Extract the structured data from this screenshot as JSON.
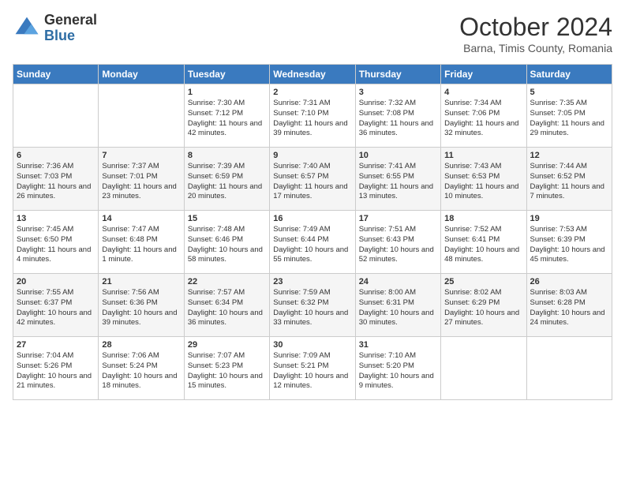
{
  "header": {
    "logo_general": "General",
    "logo_blue": "Blue",
    "month_title": "October 2024",
    "location": "Barna, Timis County, Romania"
  },
  "days_of_week": [
    "Sunday",
    "Monday",
    "Tuesday",
    "Wednesday",
    "Thursday",
    "Friday",
    "Saturday"
  ],
  "weeks": [
    [
      {
        "day": "",
        "sunrise": "",
        "sunset": "",
        "daylight": ""
      },
      {
        "day": "",
        "sunrise": "",
        "sunset": "",
        "daylight": ""
      },
      {
        "day": "1",
        "sunrise": "Sunrise: 7:30 AM",
        "sunset": "Sunset: 7:12 PM",
        "daylight": "Daylight: 11 hours and 42 minutes."
      },
      {
        "day": "2",
        "sunrise": "Sunrise: 7:31 AM",
        "sunset": "Sunset: 7:10 PM",
        "daylight": "Daylight: 11 hours and 39 minutes."
      },
      {
        "day": "3",
        "sunrise": "Sunrise: 7:32 AM",
        "sunset": "Sunset: 7:08 PM",
        "daylight": "Daylight: 11 hours and 36 minutes."
      },
      {
        "day": "4",
        "sunrise": "Sunrise: 7:34 AM",
        "sunset": "Sunset: 7:06 PM",
        "daylight": "Daylight: 11 hours and 32 minutes."
      },
      {
        "day": "5",
        "sunrise": "Sunrise: 7:35 AM",
        "sunset": "Sunset: 7:05 PM",
        "daylight": "Daylight: 11 hours and 29 minutes."
      }
    ],
    [
      {
        "day": "6",
        "sunrise": "Sunrise: 7:36 AM",
        "sunset": "Sunset: 7:03 PM",
        "daylight": "Daylight: 11 hours and 26 minutes."
      },
      {
        "day": "7",
        "sunrise": "Sunrise: 7:37 AM",
        "sunset": "Sunset: 7:01 PM",
        "daylight": "Daylight: 11 hours and 23 minutes."
      },
      {
        "day": "8",
        "sunrise": "Sunrise: 7:39 AM",
        "sunset": "Sunset: 6:59 PM",
        "daylight": "Daylight: 11 hours and 20 minutes."
      },
      {
        "day": "9",
        "sunrise": "Sunrise: 7:40 AM",
        "sunset": "Sunset: 6:57 PM",
        "daylight": "Daylight: 11 hours and 17 minutes."
      },
      {
        "day": "10",
        "sunrise": "Sunrise: 7:41 AM",
        "sunset": "Sunset: 6:55 PM",
        "daylight": "Daylight: 11 hours and 13 minutes."
      },
      {
        "day": "11",
        "sunrise": "Sunrise: 7:43 AM",
        "sunset": "Sunset: 6:53 PM",
        "daylight": "Daylight: 11 hours and 10 minutes."
      },
      {
        "day": "12",
        "sunrise": "Sunrise: 7:44 AM",
        "sunset": "Sunset: 6:52 PM",
        "daylight": "Daylight: 11 hours and 7 minutes."
      }
    ],
    [
      {
        "day": "13",
        "sunrise": "Sunrise: 7:45 AM",
        "sunset": "Sunset: 6:50 PM",
        "daylight": "Daylight: 11 hours and 4 minutes."
      },
      {
        "day": "14",
        "sunrise": "Sunrise: 7:47 AM",
        "sunset": "Sunset: 6:48 PM",
        "daylight": "Daylight: 11 hours and 1 minute."
      },
      {
        "day": "15",
        "sunrise": "Sunrise: 7:48 AM",
        "sunset": "Sunset: 6:46 PM",
        "daylight": "Daylight: 10 hours and 58 minutes."
      },
      {
        "day": "16",
        "sunrise": "Sunrise: 7:49 AM",
        "sunset": "Sunset: 6:44 PM",
        "daylight": "Daylight: 10 hours and 55 minutes."
      },
      {
        "day": "17",
        "sunrise": "Sunrise: 7:51 AM",
        "sunset": "Sunset: 6:43 PM",
        "daylight": "Daylight: 10 hours and 52 minutes."
      },
      {
        "day": "18",
        "sunrise": "Sunrise: 7:52 AM",
        "sunset": "Sunset: 6:41 PM",
        "daylight": "Daylight: 10 hours and 48 minutes."
      },
      {
        "day": "19",
        "sunrise": "Sunrise: 7:53 AM",
        "sunset": "Sunset: 6:39 PM",
        "daylight": "Daylight: 10 hours and 45 minutes."
      }
    ],
    [
      {
        "day": "20",
        "sunrise": "Sunrise: 7:55 AM",
        "sunset": "Sunset: 6:37 PM",
        "daylight": "Daylight: 10 hours and 42 minutes."
      },
      {
        "day": "21",
        "sunrise": "Sunrise: 7:56 AM",
        "sunset": "Sunset: 6:36 PM",
        "daylight": "Daylight: 10 hours and 39 minutes."
      },
      {
        "day": "22",
        "sunrise": "Sunrise: 7:57 AM",
        "sunset": "Sunset: 6:34 PM",
        "daylight": "Daylight: 10 hours and 36 minutes."
      },
      {
        "day": "23",
        "sunrise": "Sunrise: 7:59 AM",
        "sunset": "Sunset: 6:32 PM",
        "daylight": "Daylight: 10 hours and 33 minutes."
      },
      {
        "day": "24",
        "sunrise": "Sunrise: 8:00 AM",
        "sunset": "Sunset: 6:31 PM",
        "daylight": "Daylight: 10 hours and 30 minutes."
      },
      {
        "day": "25",
        "sunrise": "Sunrise: 8:02 AM",
        "sunset": "Sunset: 6:29 PM",
        "daylight": "Daylight: 10 hours and 27 minutes."
      },
      {
        "day": "26",
        "sunrise": "Sunrise: 8:03 AM",
        "sunset": "Sunset: 6:28 PM",
        "daylight": "Daylight: 10 hours and 24 minutes."
      }
    ],
    [
      {
        "day": "27",
        "sunrise": "Sunrise: 7:04 AM",
        "sunset": "Sunset: 5:26 PM",
        "daylight": "Daylight: 10 hours and 21 minutes."
      },
      {
        "day": "28",
        "sunrise": "Sunrise: 7:06 AM",
        "sunset": "Sunset: 5:24 PM",
        "daylight": "Daylight: 10 hours and 18 minutes."
      },
      {
        "day": "29",
        "sunrise": "Sunrise: 7:07 AM",
        "sunset": "Sunset: 5:23 PM",
        "daylight": "Daylight: 10 hours and 15 minutes."
      },
      {
        "day": "30",
        "sunrise": "Sunrise: 7:09 AM",
        "sunset": "Sunset: 5:21 PM",
        "daylight": "Daylight: 10 hours and 12 minutes."
      },
      {
        "day": "31",
        "sunrise": "Sunrise: 7:10 AM",
        "sunset": "Sunset: 5:20 PM",
        "daylight": "Daylight: 10 hours and 9 minutes."
      },
      {
        "day": "",
        "sunrise": "",
        "sunset": "",
        "daylight": ""
      },
      {
        "day": "",
        "sunrise": "",
        "sunset": "",
        "daylight": ""
      }
    ]
  ]
}
